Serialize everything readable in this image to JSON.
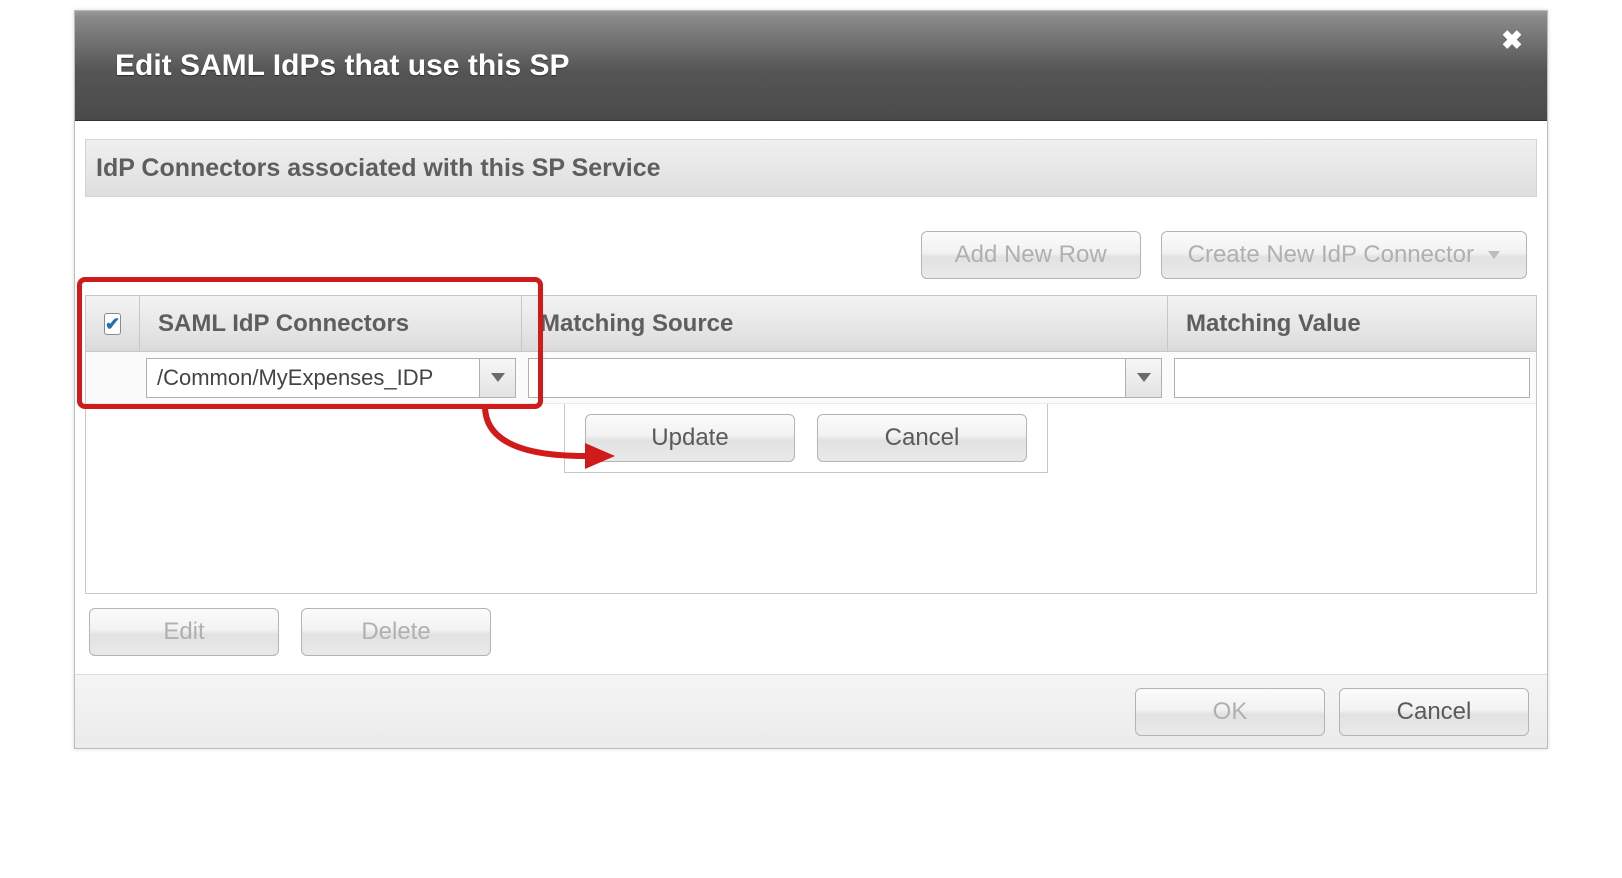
{
  "dialog": {
    "title": "Edit SAML IdPs that use this SP"
  },
  "panel": {
    "title": "IdP Connectors associated with this SP Service"
  },
  "topButtons": {
    "addRow": "Add New Row",
    "createConnector": "Create New IdP Connector"
  },
  "table": {
    "headers": {
      "connectors": "SAML IdP Connectors",
      "matchingSource": "Matching Source",
      "matchingValue": "Matching Value"
    },
    "row": {
      "connectorValue": "/Common/MyExpenses_IDP",
      "matchingSourceValue": "",
      "matchingValueValue": ""
    }
  },
  "rowActions": {
    "update": "Update",
    "cancel": "Cancel"
  },
  "listActions": {
    "edit": "Edit",
    "delete": "Delete"
  },
  "dialogActions": {
    "ok": "OK",
    "cancel": "Cancel"
  },
  "headerCheckboxChecked": true
}
